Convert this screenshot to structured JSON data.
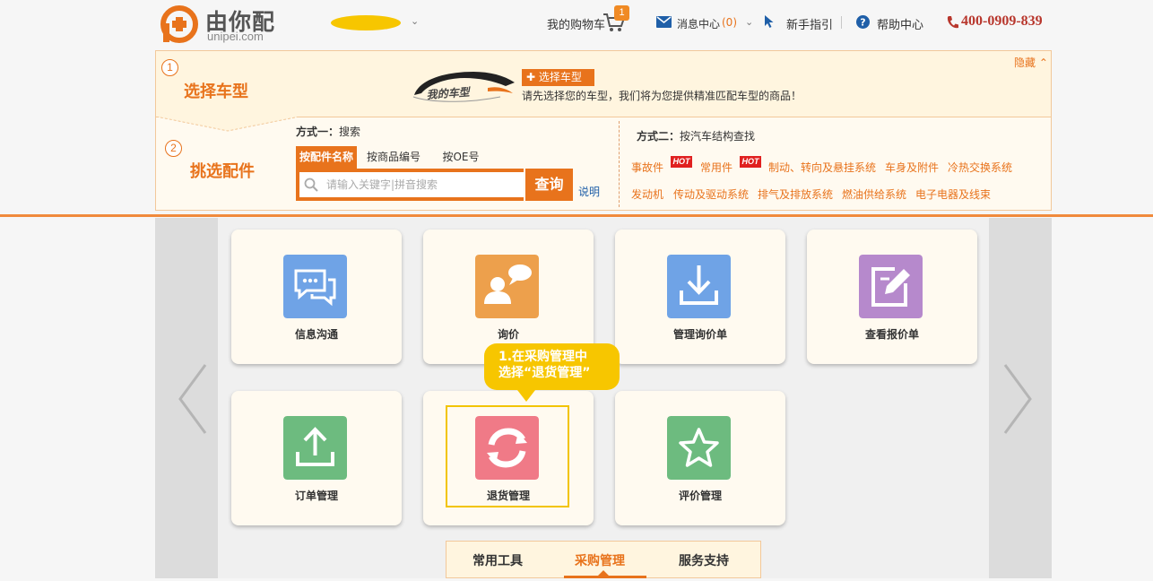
{
  "header": {
    "logo_cn": "由你配",
    "logo_en": "unipei.com",
    "cart_label": "我的购物车",
    "cart_count": "1",
    "messages_label": "消息中心",
    "messages_count": "(0)",
    "guide_label": "新手指引",
    "help_label": "帮助中心",
    "phone": "400-0909-839"
  },
  "step1": {
    "num": "1",
    "title": "选择车型",
    "hide_label": "隐藏",
    "car_logo_text": "我的车型",
    "choose_button": "选择车型",
    "tip": "请先选择您的车型，我们将为您提供精准匹配车型的商品！"
  },
  "step2": {
    "num": "2",
    "title": "挑选配件",
    "way1_prefix": "方式一：",
    "way1_text": "搜索",
    "tabs": [
      {
        "label": "按配件名称"
      },
      {
        "label": "按商品编号"
      },
      {
        "label": "按OE号"
      }
    ],
    "search_placeholder": "请输入关键字|拼音搜索",
    "search_button": "查询",
    "explain": "说明",
    "way2_prefix": "方式二：",
    "way2_text": "按汽车结构查找",
    "hot_badge": "HOT",
    "categories_row1": [
      "事故件",
      "常用件",
      "制动、转向及悬挂系统",
      "车身及附件",
      "冷热交换系统"
    ],
    "categories_row2": [
      "发动机",
      "传动及驱动系统",
      "排气及排放系统",
      "燃油供给系统",
      "电子电器及线束"
    ]
  },
  "cards": [
    {
      "label": "信息沟通",
      "color": "#6fa3e6",
      "icon": "chat-icon"
    },
    {
      "label": "询价",
      "color": "#eda04c",
      "icon": "inquiry-icon"
    },
    {
      "label": "管理询价单",
      "color": "#6fa3e6",
      "icon": "download-icon"
    },
    {
      "label": "查看报价单",
      "color": "#b689cc",
      "icon": "edit-icon"
    },
    {
      "label": "订单管理",
      "color": "#6dbb7f",
      "icon": "upload-icon"
    },
    {
      "label": "退货管理",
      "color": "#f07a87",
      "icon": "refresh-icon"
    },
    {
      "label": "评价管理",
      "color": "#6dbb7f",
      "icon": "star-icon"
    }
  ],
  "callout": {
    "line1": "1.在采购管理中",
    "line2": "选择“退货管理”"
  },
  "bottom_tabs": [
    {
      "label": "常用工具"
    },
    {
      "label": "采购管理"
    },
    {
      "label": "服务支持"
    }
  ],
  "colors": {
    "accent": "#e8731c",
    "callout": "#f7c600",
    "phone": "#b8372d",
    "link": "#1f5fa8"
  }
}
